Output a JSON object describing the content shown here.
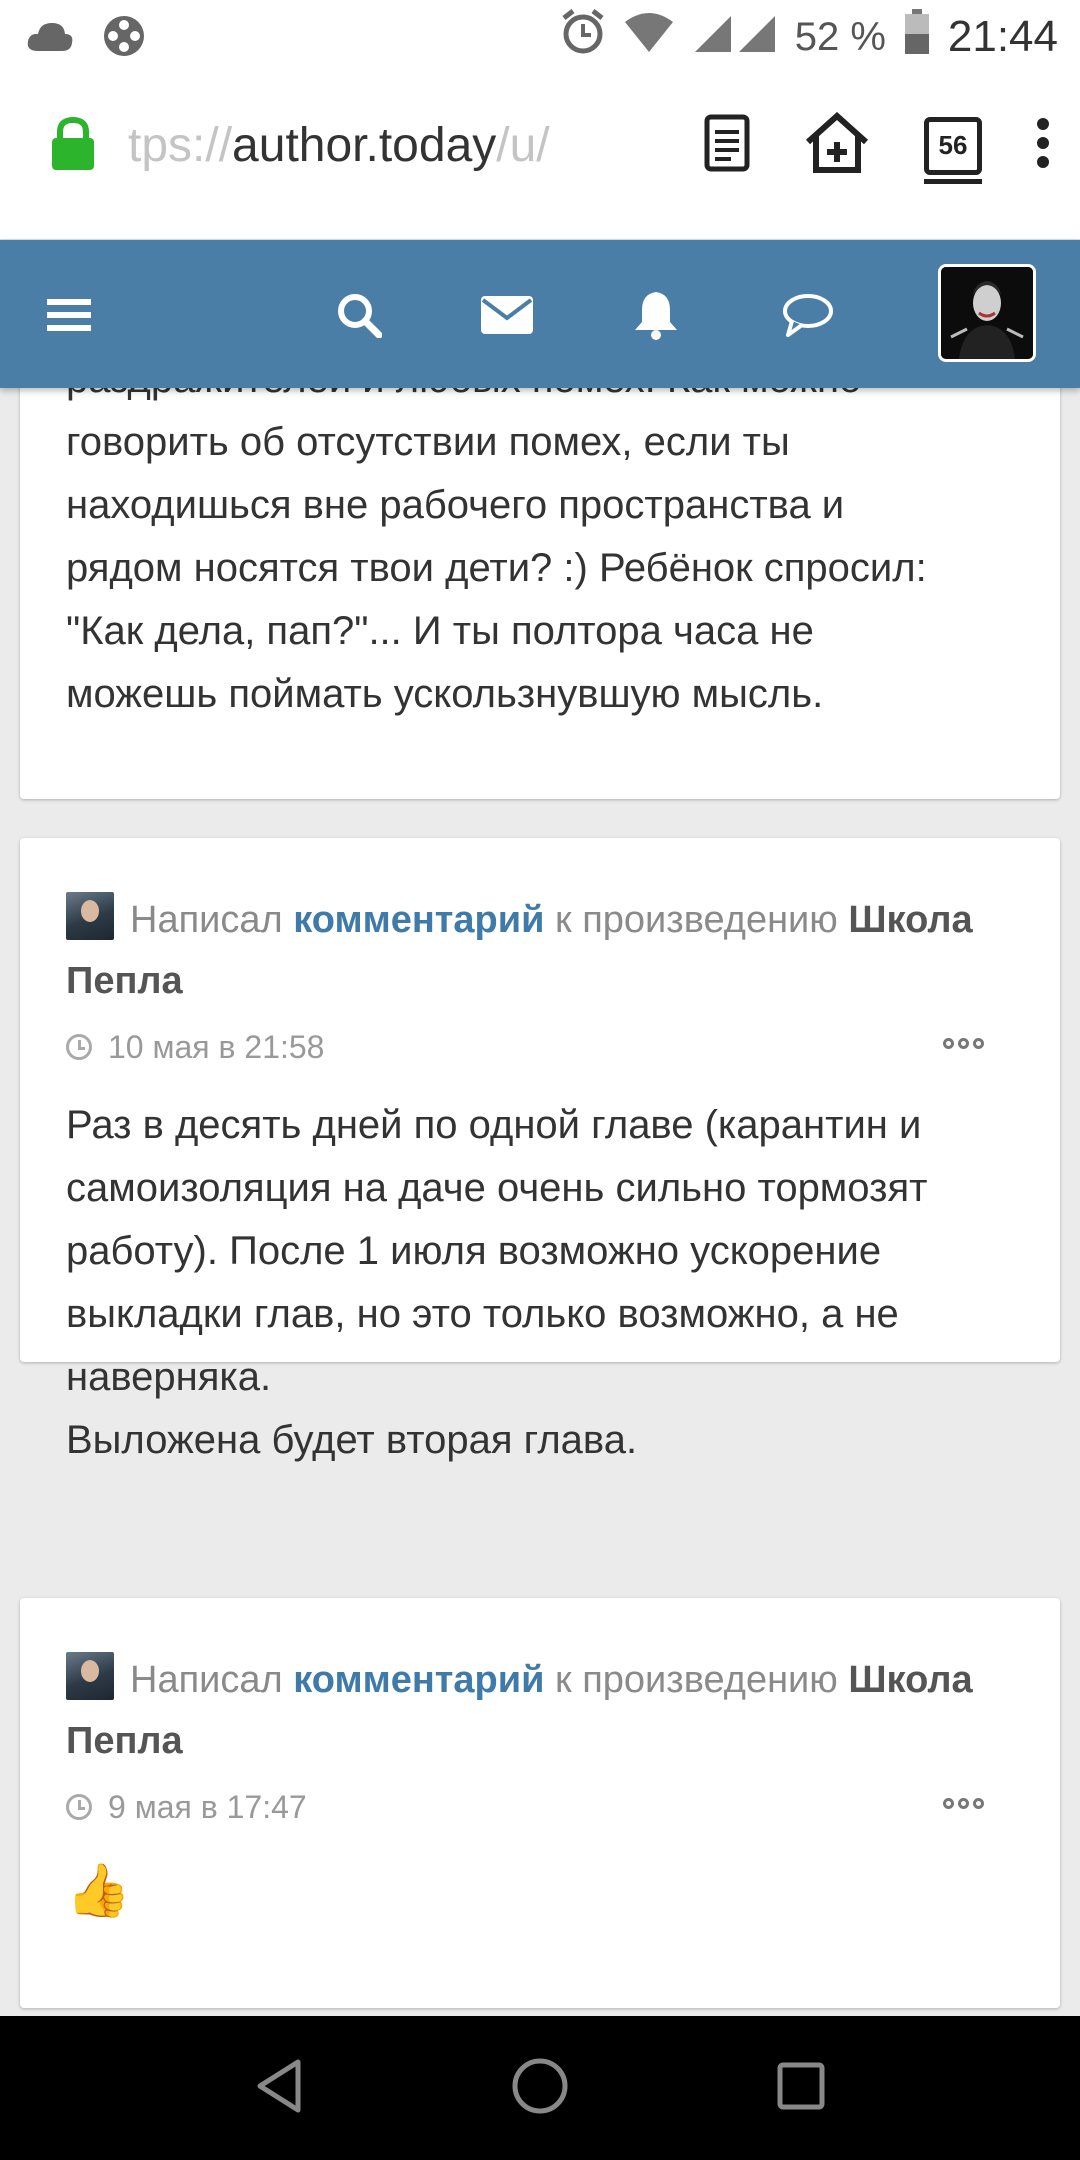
{
  "status_bar": {
    "battery_percent": "52 %",
    "time": "21:44"
  },
  "browser": {
    "url_faded": "tps://",
    "url_main": "author.today",
    "url_tail": "/u/",
    "tab_count": "56"
  },
  "cards": [
    {
      "body": "раздражителей и любых помех. Как можно\nговорить об отсутствии помех, если ты\nнаходишься вне рабочего пространства и\nрядом носятся твои дети? :) Ребёнок спросил:\n\"Как дела, пап?\"... И ты полтора часа не\nможешь поймать ускользнувшую мысль."
    },
    {
      "meta_prefix": "Написал",
      "meta_link": "комментарий",
      "meta_middle": "к произведению",
      "work_title": "Школа Пепла",
      "date": "10 мая в 21:58",
      "body": "Раз в десять дней по одной главе (карантин и\nсамоизоляция на даче очень сильно тормозят\nработу). После 1 июля возможно ускорение\nвыкладки глав, но это только возможно, а не\nнаверняка.\nВыложена будет вторая глава."
    },
    {
      "meta_prefix": "Написал",
      "meta_link": "комментарий",
      "meta_middle": "к произведению",
      "work_title": "Школа Пепла",
      "date": "9 мая в 17:47",
      "body": "👍"
    }
  ],
  "colors": {
    "header": "#4b7ea7",
    "link": "#3f7aa8",
    "lock": "#2db42d"
  },
  "icons": [
    "cloud-icon",
    "film-reel-icon",
    "alarm-icon",
    "wifi-icon",
    "signal-icon",
    "battery-icon",
    "lock-icon",
    "reader-mode-icon",
    "add-to-home-icon",
    "tabs-icon",
    "overflow-menu-icon",
    "menu-icon",
    "search-icon",
    "mail-icon",
    "bell-icon",
    "chat-icon",
    "clock-icon",
    "more-icon",
    "back-icon",
    "home-icon",
    "recents-icon"
  ]
}
